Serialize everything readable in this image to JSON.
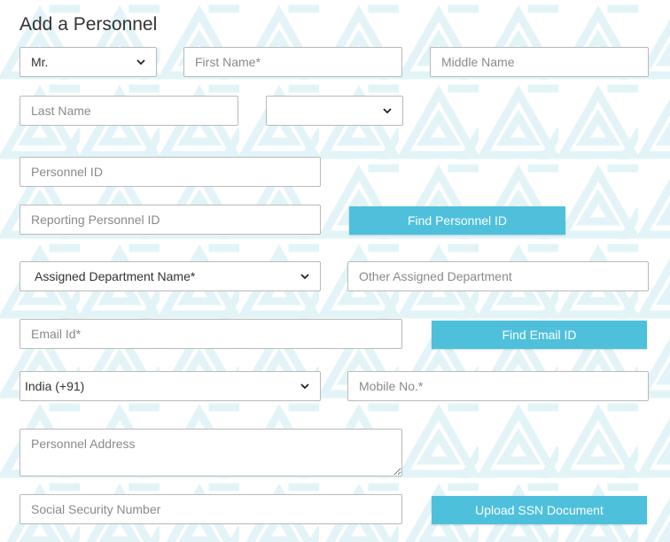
{
  "page": {
    "title": "Add a Personnel"
  },
  "name_row": {
    "salutation": {
      "value": "Mr."
    },
    "first_name": {
      "placeholder": "First Name*"
    },
    "middle_name": {
      "placeholder": "Middle Name"
    },
    "last_name": {
      "placeholder": "Last Name"
    },
    "suffix": {
      "value": ""
    }
  },
  "personnel": {
    "id": {
      "placeholder": "Personnel ID"
    },
    "reporting_id": {
      "placeholder": "Reporting Personnel ID"
    },
    "find_button": "Find Personnel ID"
  },
  "department": {
    "assigned": {
      "value": "Assigned Department Name*"
    },
    "other": {
      "placeholder": "Other Assigned Department"
    }
  },
  "email": {
    "field": {
      "placeholder": "Email Id*"
    },
    "find_button": "Find Email ID"
  },
  "phone": {
    "country": {
      "value": "India (+91)"
    },
    "mobile": {
      "placeholder": "Mobile No.*"
    }
  },
  "address": {
    "placeholder": "Personnel Address"
  },
  "ssn": {
    "field": {
      "placeholder": "Social Security Number"
    },
    "upload_button": "Upload SSN Document"
  },
  "colors": {
    "accent": "#4ec0dc",
    "pattern": "#e4f5f8",
    "border": "#b9b9b9"
  },
  "icons": {
    "select_arrow": "chevron-down-icon"
  }
}
